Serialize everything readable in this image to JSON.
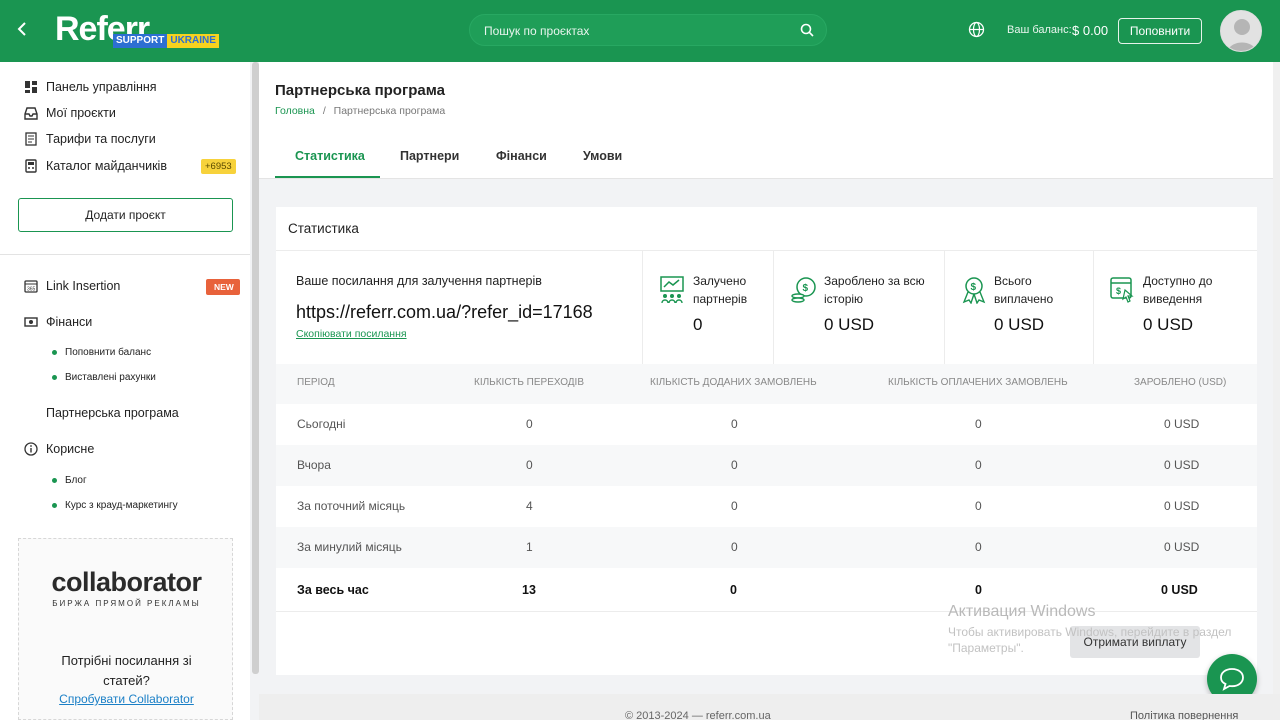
{
  "header": {
    "logo_text": "Referr",
    "logo_support": "SUPPORT",
    "logo_ukraine": "UKRAINE",
    "search_placeholder": "Пошук по проєктах",
    "balance_label": "Ваш баланс:",
    "balance_value": "$ 0.00",
    "topup_label": "Поповнити"
  },
  "sidebar": {
    "items": [
      {
        "label": "Панель управління",
        "icon": "dashboard-icon"
      },
      {
        "label": "Мої проєкти",
        "icon": "inbox-icon"
      },
      {
        "label": "Тарифи та послуги",
        "icon": "pricing-icon"
      },
      {
        "label": "Каталог майданчиків",
        "icon": "catalog-icon"
      }
    ],
    "catalog_badge": "+6953",
    "add_project": "Додати проєкт",
    "link_insertion": "Link Insertion",
    "new_badge": "NEW",
    "finance": "Фінанси",
    "finance_sub": [
      "Поповнити баланс",
      "Виставлені рахунки"
    ],
    "partner_program": "Партнерська програма",
    "useful": "Корисне",
    "useful_sub": [
      "Блог",
      "Курс з крауд-маркетингу"
    ],
    "promo": {
      "brand": "collaborator",
      "tagline": "БИРЖА ПРЯМОЙ РЕКЛАМЫ",
      "question": "Потрібні посилання зі статей?",
      "cta": "Спробувати Collaborator"
    }
  },
  "page": {
    "title": "Партнерська програма",
    "breadcrumb_home": "Головна",
    "breadcrumb_sep": "/",
    "breadcrumb_current": "Партнерська програма",
    "tabs": [
      "Статистика",
      "Партнери",
      "Фінанси",
      "Умови"
    ]
  },
  "stats": {
    "card_title": "Статистика",
    "ref_label": "Ваше посилання для залучення партнерів",
    "ref_link": "https://referr.com.ua/?refer_id=17168",
    "copy_link": "Скопіювати посилання",
    "boxes": [
      {
        "label1": "Залучено",
        "label2": "партнерів",
        "value": "0",
        "icon": "partners-icon"
      },
      {
        "label1": "Зароблено за всю",
        "label2": "історію",
        "value": "0 USD",
        "icon": "coins-icon"
      },
      {
        "label1": "Всього",
        "label2": "виплачено",
        "value": "0 USD",
        "icon": "award-icon"
      },
      {
        "label1": "Доступно до",
        "label2": "виведення",
        "value": "0 USD",
        "icon": "withdraw-icon"
      }
    ]
  },
  "table": {
    "headers": [
      "Період",
      "Кількість переходів",
      "Кількість доданих замовлень",
      "Кількість оплачених замовлень",
      "Зароблено (USD)"
    ],
    "rows": [
      [
        "Сьогодні",
        "0",
        "0",
        "0",
        "0 USD"
      ],
      [
        "Вчора",
        "0",
        "0",
        "0",
        "0 USD"
      ],
      [
        "За поточний місяць",
        "4",
        "0",
        "0",
        "0 USD"
      ],
      [
        "За минулий місяць",
        "1",
        "0",
        "0",
        "0 USD"
      ]
    ],
    "total": [
      "За весь час",
      "13",
      "0",
      "0",
      "0 USD"
    ]
  },
  "payout_button": "Отримати виплату",
  "watermark": {
    "title": "Активация Windows",
    "line1": "Чтобы активировать Windows, перейдите в раздел",
    "line2": "\"Параметры\"."
  },
  "footer": {
    "copyright": "© 2013-2024 — referr.com.ua",
    "refund": "Політика повернення"
  },
  "colors": {
    "brand": "#1a9551",
    "accent_badge": "#f7d23b",
    "new_badge": "#e8623b"
  }
}
